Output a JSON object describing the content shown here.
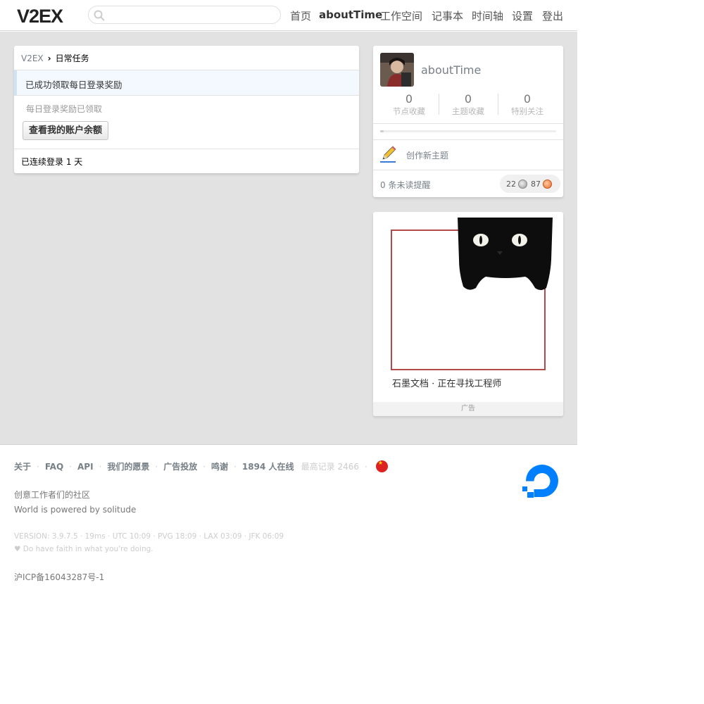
{
  "header": {
    "logo": "V2EX",
    "search_placeholder": "",
    "nav": [
      "首页",
      "aboutTime",
      "工作空间",
      "记事本",
      "时间轴",
      "设置",
      "登出"
    ]
  },
  "mission": {
    "breadcrumb_home": "V2EX",
    "breadcrumb_sep": "›",
    "breadcrumb_current": "日常任务",
    "success_notice": "已成功领取每日登录奖励",
    "claimed_text": "每日登录奖励已领取",
    "balance_button": "查看我的账户余额",
    "streak": "已连续登录 1 天"
  },
  "user": {
    "username": "aboutTime",
    "stats": [
      {
        "num": "0",
        "label": "节点收藏"
      },
      {
        "num": "0",
        "label": "主题收藏"
      },
      {
        "num": "0",
        "label": "特别关注"
      }
    ],
    "progress": 0.02,
    "create_topic": "创作新主题",
    "unread": "0 条未读提醒",
    "silver": "22",
    "bronze": "87"
  },
  "ad": {
    "text": "石墨文档 · 正在寻找工程师",
    "footer": "广告"
  },
  "footer": {
    "links": [
      "关于",
      "FAQ",
      "API",
      "我们的愿景",
      "广告投放",
      "鸣谢"
    ],
    "online": "1894 人在线",
    "record": "最高记录 2466",
    "sep": "·",
    "tagline": "创意工作者们的社区",
    "powered": "World is powered by solitude",
    "version": "VERSION: 3.9.7.5 · 19ms · UTC 10:09 · PVG 18:09 · LAX 03:09 · JFK 06:09",
    "faith": "♥ Do have faith in what you're doing.",
    "icp": "沪ICP备16043287号-1"
  },
  "colors": {
    "link_gray": "#778087",
    "page_bg": "#e2e2e2",
    "ad_border": "#b34a4a",
    "do_blue": "#0080ff"
  }
}
